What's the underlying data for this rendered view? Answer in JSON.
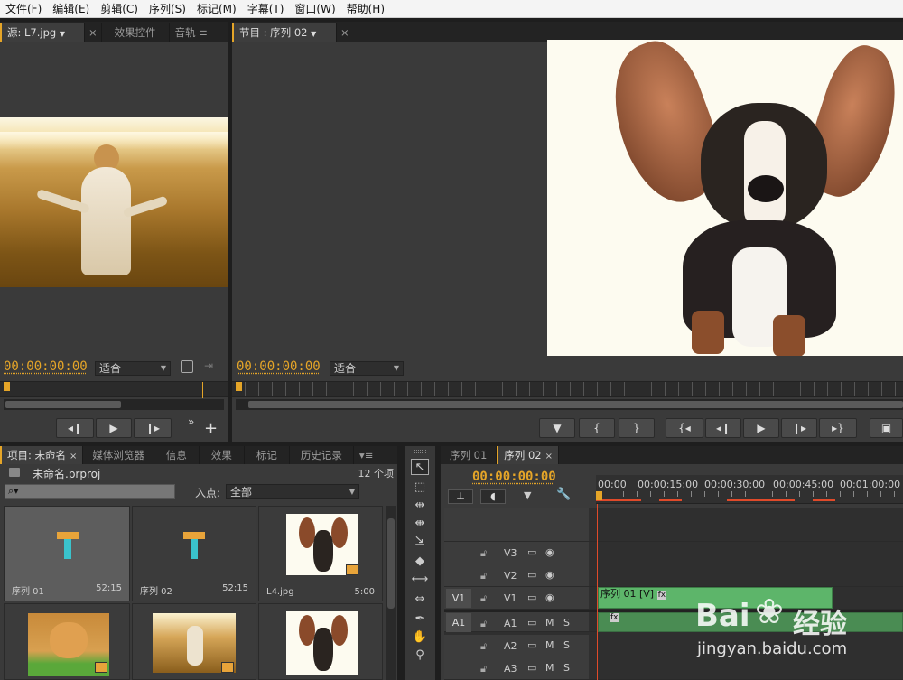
{
  "menu": [
    "文件(F)",
    "编辑(E)",
    "剪辑(C)",
    "序列(S)",
    "标记(M)",
    "字幕(T)",
    "窗口(W)",
    "帮助(H)"
  ],
  "source_panel": {
    "tab_source": "源: L7.jpg",
    "tab_effects": "效果控件",
    "tab_audio": "音轨",
    "timecode": "00:00:00:00",
    "fit": "适合"
  },
  "program_panel": {
    "tab": "节目 : 序列 02",
    "timecode": "00:00:00:00",
    "fit": "适合"
  },
  "project_panel": {
    "tabs": [
      "项目: 未命名",
      "媒体浏览器",
      "信息",
      "效果",
      "标记",
      "历史记录"
    ],
    "project_name": "未命名.prproj",
    "count": "12 个项",
    "in_label": "入点:",
    "in_value": "全部",
    "items": [
      {
        "name": "序列 01",
        "duration": "52:15"
      },
      {
        "name": "序列 02",
        "duration": "52:15"
      },
      {
        "name": "L4.jpg",
        "duration": "5:00"
      },
      {
        "name": "",
        "duration": ""
      },
      {
        "name": "",
        "duration": ""
      },
      {
        "name": "",
        "duration": ""
      }
    ]
  },
  "timeline": {
    "tabs": [
      "序列 01",
      "序列 02"
    ],
    "timecode": "00:00:00:00",
    "ruler": [
      "00:00",
      "00:00:15:00",
      "00:00:30:00",
      "00:00:45:00",
      "00:01:00:00"
    ],
    "video_tracks": [
      "V3",
      "V2",
      "V1"
    ],
    "audio_tracks": [
      "A1",
      "A2",
      "A3"
    ],
    "src_v": "V1",
    "src_a": "A1",
    "clip_label": "序列 01 [V]",
    "fx": "fx"
  },
  "watermark": {
    "brand": "Bai",
    "brand2": "经验",
    "url": "jingyan.baidu.com"
  },
  "colors": {
    "accent": "#e5a528",
    "clip": "#5db56a",
    "playhead": "#e04a2a"
  }
}
